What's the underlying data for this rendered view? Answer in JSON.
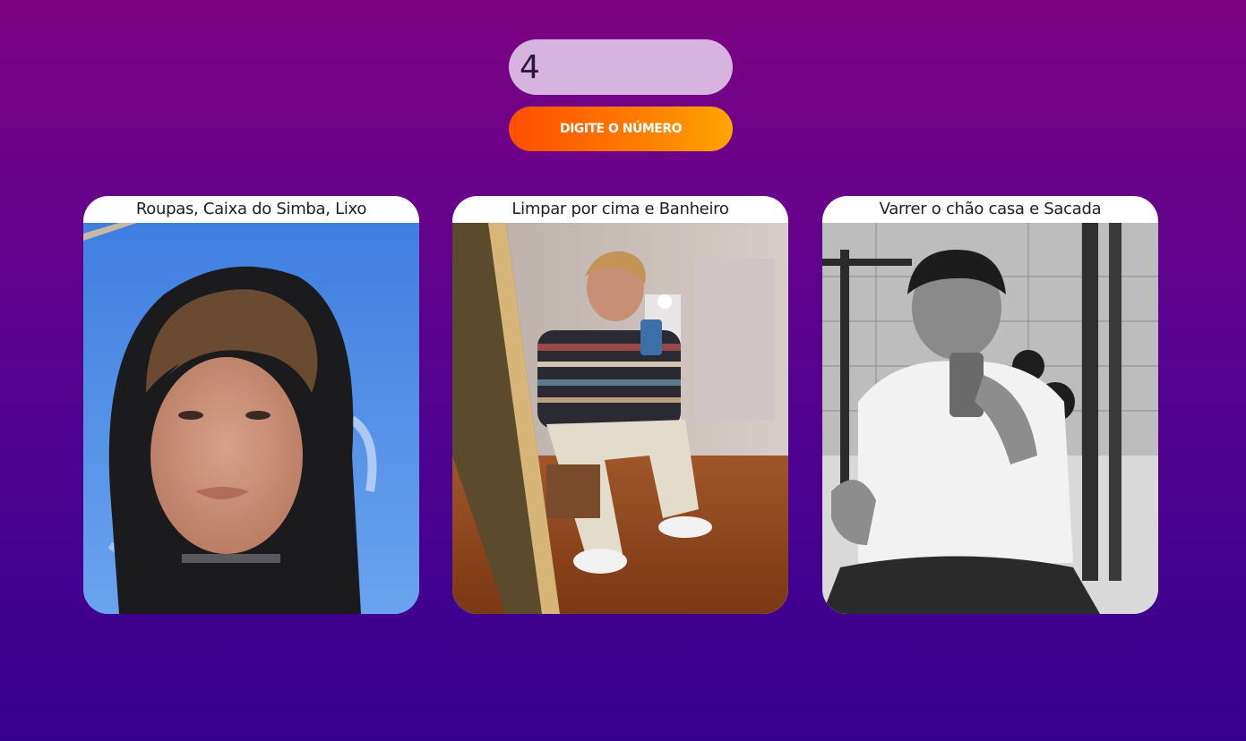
{
  "input": {
    "value": "4"
  },
  "button": {
    "label": "DIGITE O NÚMERO"
  },
  "cards": [
    {
      "title": "Roupas, Caixa do Simba, Lixo"
    },
    {
      "title": "Limpar por cima e Banheiro"
    },
    {
      "title": "Varrer o chão casa e Sacada"
    }
  ],
  "colors": {
    "background_top": "#7d0383",
    "background_bottom": "#34018e",
    "input_background": "#d7b4df",
    "button_gradient_start": "#ff4e02",
    "button_gradient_end": "#ffa500"
  }
}
